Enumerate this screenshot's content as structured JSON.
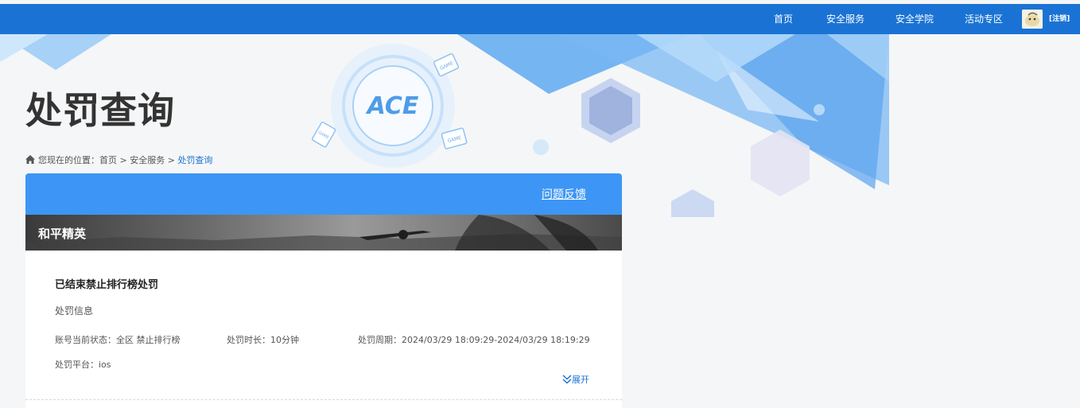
{
  "nav": {
    "items": [
      "首页",
      "安全服务",
      "安全学院",
      "活动专区"
    ],
    "logout": "[注销]"
  },
  "banner": {
    "logo_text": "ACE",
    "game_badges": [
      "GAME",
      "GAME",
      "GAME"
    ]
  },
  "page": {
    "title": "处罚查询"
  },
  "breadcrumb": {
    "prefix": "您现在的位置：",
    "home": "首页",
    "sep1": " > ",
    "section": "安全服务",
    "sep2": " > ",
    "current": "处罚查询"
  },
  "card": {
    "feedback": "问题反馈",
    "game_name": "和平精英",
    "punishment": {
      "title": "已结束禁止排行榜处罚",
      "subtitle": "处罚信息",
      "status": "账号当前状态：全区 禁止排行榜",
      "duration": "处罚时长：10分钟",
      "period": "处罚周期：2024/03/29 18:09:29-2024/03/29 18:19:29",
      "platform": "处罚平台：ios",
      "expand": "展开"
    }
  },
  "colors": {
    "nav": "#1a73d4",
    "card_header": "#3d96f5",
    "link": "#1a73d4"
  }
}
